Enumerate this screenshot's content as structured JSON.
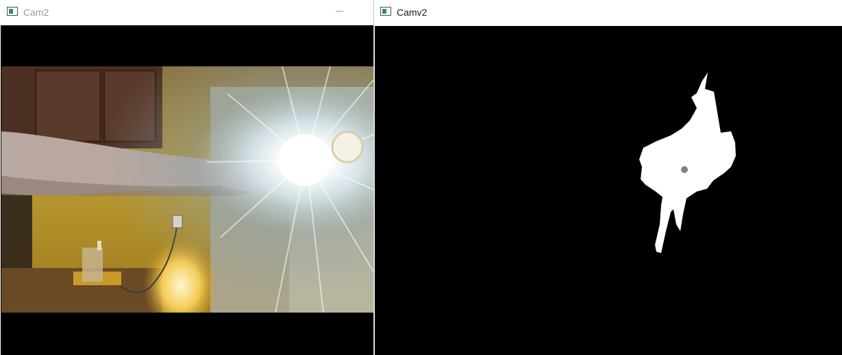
{
  "windows": [
    {
      "title": "Cam2",
      "controls": {
        "minimize_icon": "minimize-icon"
      }
    },
    {
      "title": "Camv2"
    }
  ],
  "icons": {
    "window_icon": "opencv-window-icon"
  },
  "colors": {
    "titlebar_bg": "#ffffff",
    "inactive_title": "#9a9a9a",
    "active_title": "#1a1a1a",
    "viewport_bg": "#000000",
    "mask_blob": "#ffffff",
    "centroid_dot": "#808080"
  }
}
